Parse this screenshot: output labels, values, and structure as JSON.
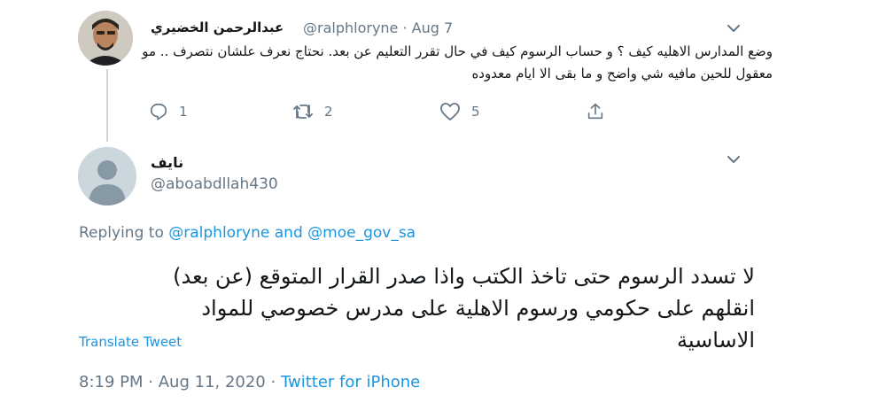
{
  "reply_tweet": {
    "display_name": "عبدالرحمن الخضيري",
    "handle": "@ralphloryne",
    "separator": "·",
    "date": "Aug 7",
    "text": "وضع المدارس الاهليه كيف ؟ و حساب الرسوم كيف في حال تقرر التعليم عن بعد. نحتاج نعرف علشان نتصرف .. مو معقول للحين مافيه شي واضح و ما بقى الا ايام معدوده",
    "actions": {
      "reply_count": "1",
      "retweet_count": "2",
      "like_count": "5"
    }
  },
  "main_tweet": {
    "display_name": "نايف",
    "handle": "@aboabdllah430",
    "replying_prefix": "Replying to",
    "replying_mention_1": "@ralphloryne",
    "replying_and": "and",
    "replying_mention_2": "@moe_gov_sa",
    "text": "لا تسدد الرسوم حتى تاخذ الكتب واذا صدر القرار المتوقع (عن بعد) انقلهم على حكومي ورسوم الاهلية على مدرس خصوصي للمواد الاساسية",
    "translate_label": "Translate Tweet",
    "time": "8:19 PM",
    "date": "Aug 11, 2020",
    "separator": "·",
    "source": "Twitter for iPhone"
  },
  "icons": {
    "reply": "reply-icon",
    "retweet": "retweet-icon",
    "like": "heart-icon",
    "share": "share-icon",
    "more": "chevron-down-icon",
    "default_avatar": "default-avatar-icon"
  },
  "colors": {
    "link_blue": "#1b95e0",
    "secondary_gray": "#657786",
    "text_dark": "#14171a",
    "divider": "#ccd6dd"
  }
}
